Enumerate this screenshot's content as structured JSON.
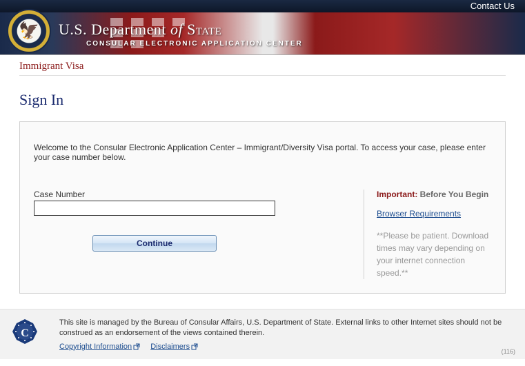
{
  "topbar": {
    "contact": "Contact Us"
  },
  "header": {
    "department": "U.S. Department",
    "of": "of",
    "state": "State",
    "subtitle": "CONSULAR ELECTRONIC APPLICATION CENTER"
  },
  "breadcrumb": "Immigrant Visa",
  "page_title": "Sign In",
  "welcome": "Welcome to the Consular Electronic Application Center – Immigrant/Diversity Visa portal. To access your case, please enter your case number below.",
  "form": {
    "case_label": "Case Number",
    "case_value": "",
    "continue": "Continue"
  },
  "sidebar": {
    "important_label": "Important:",
    "important_text": " Before You Begin",
    "browser_req": "Browser Requirements",
    "patience": "**Please be patient. Download times may vary depending on your internet connection speed.**"
  },
  "footer": {
    "disclaimer": "This site is managed by the Bureau of Consular Affairs, U.S. Department of State. External links to other Internet sites should not be construed as an endorsement of the views contained therein.",
    "copyright": "Copyright Information",
    "disclaimers": "Disclaimers",
    "page_num": "(116)"
  }
}
